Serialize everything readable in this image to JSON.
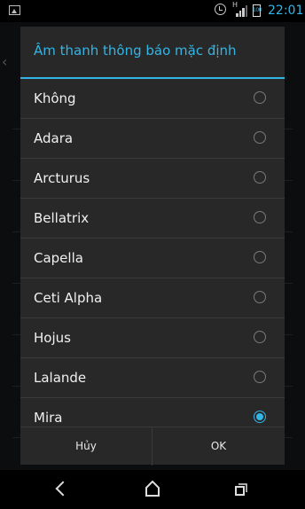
{
  "status_bar": {
    "time": "22:01",
    "network_label": "H",
    "battery_label": "100",
    "accent_color": "#33b5e5"
  },
  "dialog": {
    "title": "Âm thanh thông báo mặc định",
    "items": [
      {
        "label": "Không",
        "selected": false
      },
      {
        "label": "Adara",
        "selected": false
      },
      {
        "label": "Arcturus",
        "selected": false
      },
      {
        "label": "Bellatrix",
        "selected": false
      },
      {
        "label": "Capella",
        "selected": false
      },
      {
        "label": "Ceti Alpha",
        "selected": false
      },
      {
        "label": "Hojus",
        "selected": false
      },
      {
        "label": "Lalande",
        "selected": false
      },
      {
        "label": "Mira",
        "selected": true
      }
    ],
    "cancel_label": "Hủy",
    "ok_label": "OK"
  },
  "nav": {
    "back_icon": "back-icon",
    "home_icon": "home-icon",
    "recent_icon": "recent-apps-icon"
  }
}
